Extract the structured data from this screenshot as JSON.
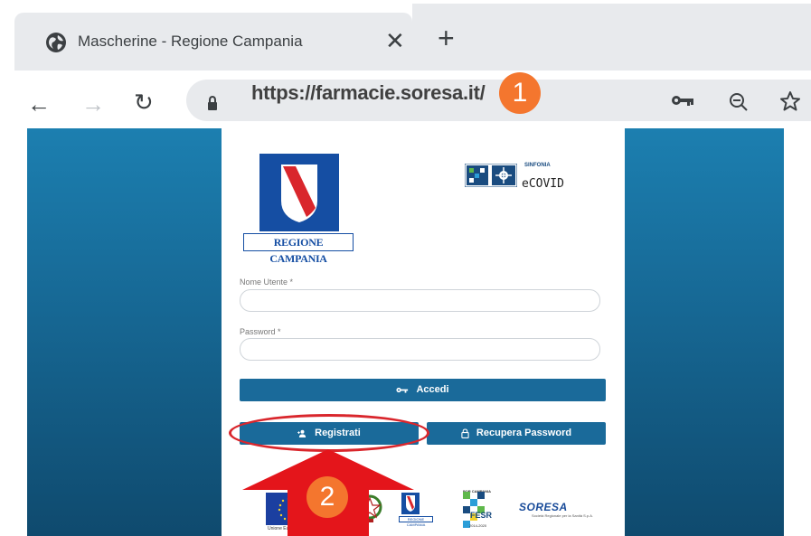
{
  "browser": {
    "tab_title": "Mascherine - Regione Campania",
    "tab_close": "✕",
    "new_tab": "+",
    "back": "←",
    "forward": "→",
    "reload": "↻",
    "url": "https://farmacie.soresa.it/",
    "icons": {
      "globe": "globe-icon",
      "lock": "lock-icon",
      "key": "key-icon",
      "zoom": "zoom-out-icon",
      "star": "star-icon"
    }
  },
  "callouts": {
    "step1": "1",
    "step2": "2",
    "badge_color": "#f4762e",
    "highlight_color": "#d9262c"
  },
  "header": {
    "region_label": "REGIONE CAMPANIA",
    "sinfonia_label": "SINFONIA",
    "ecovid_label": "eCOVID"
  },
  "form": {
    "username_label": "Nome Utente *",
    "username_value": "",
    "password_label": "Password *",
    "password_value": "",
    "login_label": "Accedi",
    "register_label": "Registrati",
    "recover_label": "Recupera Password"
  },
  "footer": {
    "eu_label": "Unione Europea",
    "region_small_label": "REGIONE CAMPANIA",
    "fesr_top_label": "POR CAMPANIA",
    "fesr_label": "FESR",
    "fesr_years": "2014-2020",
    "soresa_label": "SORESA",
    "soresa_sub": "Società Regionale per la Sanità S.p.A."
  },
  "colors": {
    "primary_button": "#1a6a9a",
    "page_background_top": "#1c7fb0",
    "page_background_bottom": "#0f4a6e",
    "region_blue": "#154ea3"
  }
}
